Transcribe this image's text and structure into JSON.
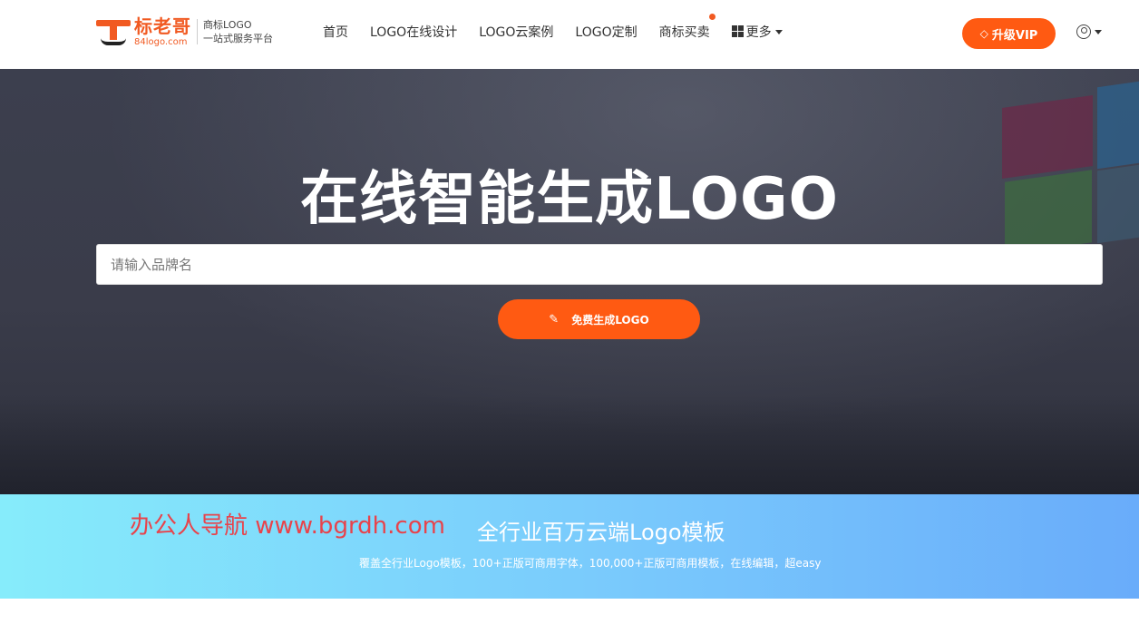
{
  "logo": {
    "name": "标老哥",
    "domain": "84logo.com",
    "tag_line1": "商标LOGO",
    "tag_line2": "一站式服务平台"
  },
  "nav": {
    "items": [
      {
        "label": "首页"
      },
      {
        "label": "LOGO在线设计"
      },
      {
        "label": "LOGO云案例"
      },
      {
        "label": "LOGO定制"
      },
      {
        "label": "商标买卖"
      }
    ],
    "more_label": "更多"
  },
  "header": {
    "vip_label": "升级VIP"
  },
  "hero": {
    "title": "在线智能生成LOGO",
    "search_placeholder": "请输入品牌名",
    "generate_label": "免费生成LOGO"
  },
  "banner": {
    "watermark": "办公人导航 www.bgrdh.com",
    "title": "全行业百万云端Logo模板",
    "subtitle": "覆盖全行业Logo模板，100+正版可商用字体，100,000+正版可商用模板，在线编辑，超easy"
  },
  "colors": {
    "accent": "#ff5a12",
    "banner_start": "#86ecfb",
    "banner_end": "#69acfa"
  }
}
